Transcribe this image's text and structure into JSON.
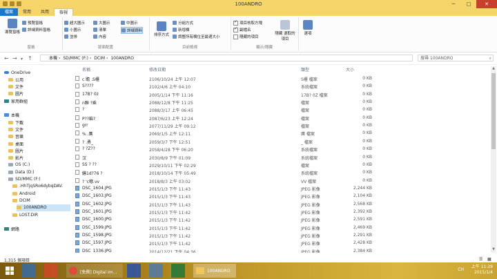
{
  "window": {
    "title": "100ANDRO"
  },
  "tabs": [
    "檔案",
    "常用",
    "共用",
    "檢視"
  ],
  "ribbon": {
    "pane_group": {
      "label": "窗格",
      "nav_pane": "導覽窗格",
      "preview": "預覽窗格",
      "details": "詳細資料窗格"
    },
    "layout_group": {
      "label": "版面配置",
      "options": [
        "超大圖示",
        "大圖示",
        "中圖示",
        "小圖示",
        "清單",
        "詳細資料",
        "並排",
        "內容"
      ],
      "selected": "詳細資料"
    },
    "view_group": {
      "label": "目前檢視",
      "sort": "排序方式",
      "group_by": "分組方式",
      "add_columns": "新增欄",
      "fit_columns": "調整所有欄位至最適大小"
    },
    "showhide_group": {
      "label": "顯示/隱藏",
      "item_checkboxes": "項目核取方塊",
      "extensions": "副檔名",
      "hidden_items": "隱藏的項目",
      "hide_selected": "隱藏 選取的項目"
    },
    "options": "選項"
  },
  "address": {
    "crumbs": [
      "本機",
      "SD/MMC (F:)",
      "DCIM",
      "100ANDRO"
    ],
    "search_placeholder": "搜尋 100ANDRO"
  },
  "nav": [
    {
      "label": "OneDrive",
      "kind": "cloud",
      "indent": 0
    },
    {
      "label": "公用",
      "kind": "folder",
      "indent": 1
    },
    {
      "label": "文件",
      "kind": "folder",
      "indent": 1
    },
    {
      "label": "圖片",
      "kind": "folder",
      "indent": 1
    },
    {
      "label": "家用群組",
      "kind": "net",
      "indent": 0
    },
    {
      "label": "",
      "kind": "",
      "indent": 0
    },
    {
      "label": "本機",
      "kind": "pc",
      "indent": 0
    },
    {
      "label": "下載",
      "kind": "folder",
      "indent": 1
    },
    {
      "label": "文件",
      "kind": "folder",
      "indent": 1
    },
    {
      "label": "音樂",
      "kind": "folder",
      "indent": 1
    },
    {
      "label": "桌面",
      "kind": "folder",
      "indent": 1
    },
    {
      "label": "圖片",
      "kind": "folder",
      "indent": 1
    },
    {
      "label": "影片",
      "kind": "folder",
      "indent": 1
    },
    {
      "label": "OS (C:)",
      "kind": "drive",
      "indent": 1
    },
    {
      "label": "Data (D:)",
      "kind": "drive",
      "indent": 1
    },
    {
      "label": "SD/MMC (F:)",
      "kind": "drive",
      "indent": 1
    },
    {
      "label": ".HhTjqSRo6dybqDAV.",
      "kind": "folder",
      "indent": 2
    },
    {
      "label": "Android",
      "kind": "folder",
      "indent": 2
    },
    {
      "label": "DCIM",
      "kind": "folder",
      "indent": 2
    },
    {
      "label": "100ANDRO",
      "kind": "folder",
      "indent": 3
    },
    {
      "label": "LOST.DIR",
      "kind": "folder",
      "indent": 2
    },
    {
      "label": "",
      "kind": "",
      "indent": 0
    },
    {
      "label": "網路",
      "kind": "net",
      "indent": 0
    }
  ],
  "nav_selected": "100ANDRO",
  "columns": {
    "name": "名稱",
    "date": "修改日期",
    "type": "類型",
    "size": "大小"
  },
  "files": [
    {
      "name": "c   瞻    .S櫃",
      "date": "2106/10/24 上午 12:07",
      "type": "S櫃 檔案",
      "size": "0 KB",
      "jpg": false
    },
    {
      "name": "      S????",
      "date": "2102/4/6 上午 04:10",
      "type": "系統檔案",
      "size": "0 KB",
      "jpg": false
    },
    {
      "name": "17B?  0z",
      "date": "2005/1/14 下午 11:16",
      "type": "17B? 0Z 檔案",
      "size": "0 KB",
      "jpg": false
    },
    {
      "name": "n聯 ?乘",
      "date": "2088/12/8 下午 11:25",
      "type": "檔案",
      "size": "0 KB",
      "jpg": false
    },
    {
      "name": "?",
      "date": "2088/3/17 上午 06:45",
      "type": "檔案",
      "size": "0 KB",
      "jpg": false
    },
    {
      "name": "P??餡?",
      "date": "2087/6/23 上午 12:24",
      "type": "檔案",
      "size": "0 KB",
      "jpg": false
    },
    {
      "name": "grr",
      "date": "2077/11/29 上午 09:12",
      "type": "檔案",
      "size": "0 KB",
      "jpg": false
    },
    {
      "name": "      %     .膺",
      "date": "2069/1/5 上午 12:11",
      "type": "膺 檔案",
      "size": "0 KB",
      "jpg": false
    },
    {
      "name": "?       .勇_",
      "date": "2059/3/7 下午 12:51",
      "type": "_ 檔案",
      "size": "0 KB",
      "jpg": false
    },
    {
      "name": "?  ?Z??",
      "date": "2058/4/28 下午 06:20",
      "type": "系統檔案",
      "size": "0 KB",
      "jpg": false
    },
    {
      "name": "  汉",
      "date": "2030/8/9 下午 01:09",
      "type": "系統檔案",
      "size": "0 KB",
      "jpg": false
    },
    {
      "name": "SS    ? ??",
      "date": "2029/10/11 下午 02:29",
      "type": "檔案",
      "size": "0 KB",
      "jpg": false
    },
    {
      "name": "繕1d?76 ?",
      "date": "2018/10/14 下午 05:49",
      "type": "系統檔案",
      "size": "0 KB",
      "jpg": false
    },
    {
      "name": "?    'c穗.vv",
      "date": "2018/8/3 上午 03:02",
      "type": "VV 檔案",
      "size": "0 KB",
      "jpg": false
    },
    {
      "name": "DSC_1604.JPG",
      "date": "2015/1/3 下午 11:43",
      "type": "JPEG 影像",
      "size": "2,244 KB",
      "jpg": true
    },
    {
      "name": "DSC_1603.JPG",
      "date": "2015/1/3 下午 11:43",
      "type": "JPEG 影像",
      "size": "2,104 KB",
      "jpg": true
    },
    {
      "name": "DSC_1602.JPG",
      "date": "2015/1/3 下午 11:43",
      "type": "JPEG 影像",
      "size": "2,568 KB",
      "jpg": true
    },
    {
      "name": "DSC_1601.JPG",
      "date": "2015/1/3 下午 11:42",
      "type": "JPEG 影像",
      "size": "2,392 KB",
      "jpg": true
    },
    {
      "name": "DSC_1600.JPG",
      "date": "2015/1/3 下午 11:42",
      "type": "JPEG 影像",
      "size": "2,591 KB",
      "jpg": true
    },
    {
      "name": "DSC_1599.JPG",
      "date": "2015/1/3 下午 11:42",
      "type": "JPEG 影像",
      "size": "2,469 KB",
      "jpg": true
    },
    {
      "name": "DSC_1598.JPG",
      "date": "2015/1/3 下午 11:42",
      "type": "JPEG 影像",
      "size": "2,291 KB",
      "jpg": true
    },
    {
      "name": "DSC_1597.JPG",
      "date": "2015/1/3 下午 11:42",
      "type": "JPEG 影像",
      "size": "2,428 KB",
      "jpg": true
    },
    {
      "name": "DSC_1336.JPG",
      "date": "2014/12/21 下午 04:36",
      "type": "JPEG 影像",
      "size": "2,384 KB",
      "jpg": true
    }
  ],
  "status": {
    "count": "1,315 個項目"
  },
  "taskbar": {
    "apps": [
      {
        "label": ""
      },
      {
        "label": ""
      },
      {
        "label": ""
      },
      {
        "label": "[免費] Digital Im..."
      },
      {
        "label": ""
      },
      {
        "label": ""
      },
      {
        "label": ""
      },
      {
        "label": "100ANDRO"
      }
    ],
    "tray_text": "CH",
    "time": "上午 11:29",
    "date": "2015/1/4"
  },
  "colors": {
    "title_bar": "#f5d56a",
    "file_tab": "#1979ca",
    "close": "#c7402b",
    "selected": "#cce4f7"
  }
}
